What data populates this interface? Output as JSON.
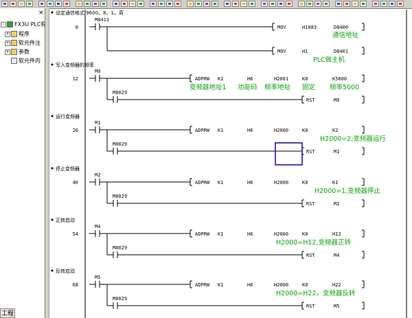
{
  "left_panel": {
    "close_glyph": "×",
    "project_title": "FX3U PLC程",
    "items": [
      {
        "label": "程序",
        "expander": "+"
      },
      {
        "label": "软元件注",
        "expander": "+"
      },
      {
        "label": "参数",
        "expander": "+"
      },
      {
        "label": "软元件内",
        "expander": ""
      }
    ],
    "bottom_tab": "工程"
  },
  "ladder": {
    "rungs": [
      {
        "comment": "设定通信格式 9600，8，1，奇",
        "step": "0",
        "contact": "M8411",
        "outputs": [
          {
            "instr": "MOV",
            "ops": [
              "H1083",
              "D8400"
            ],
            "note": "通信地址"
          },
          {
            "instr": "MOV",
            "ops": [
              "H1",
              "D8401"
            ],
            "note": "PLC做主机"
          }
        ]
      },
      {
        "comment": "写入变频器的频率",
        "step": "12",
        "contact": "M0",
        "instr": "ADPRW",
        "ops": [
          "K1",
          "H6",
          "H2001",
          "K0",
          "K5000"
        ],
        "op_notes": [
          "变频器地址1",
          "功能码",
          "频率地址",
          "固定",
          "频率5000"
        ],
        "contact2": "M8029",
        "rst": "RST",
        "rst_op": "M0"
      },
      {
        "comment": "运行变频器",
        "step": "26",
        "contact": "M1",
        "instr": "ADPRW",
        "ops": [
          "K1",
          "H6",
          "H2000",
          "K0",
          "K2"
        ],
        "note": "H2000=2,变频器运行",
        "contact2": "M8029",
        "rst": "RST",
        "rst_op": "M1"
      },
      {
        "comment": "停止变频器",
        "step": "40",
        "contact": "M2",
        "instr": "ADPRW",
        "ops": [
          "K1",
          "H6",
          "H2000",
          "K0",
          "K1"
        ],
        "note": "H2000=1,变频器停止",
        "contact2": "M8029",
        "rst": "RST",
        "rst_op": "M2"
      },
      {
        "comment": "正转启动",
        "step": "54",
        "contact": "M4",
        "instr": "ADPRW",
        "ops": [
          "K1",
          "H6",
          "H2000",
          "K0",
          "H12"
        ],
        "note": "H2000=H12,变频器正转",
        "contact2": "M8029",
        "rst": "RST",
        "rst_op": "M4"
      },
      {
        "comment": "反转启动",
        "step": "68",
        "contact": "M5",
        "instr": "ADPRW",
        "ops": [
          "K1",
          "H6",
          "H2000",
          "K0",
          "H22"
        ],
        "note": "H2000=H22，变频器反转",
        "contact2": "M8029",
        "rst": "RST",
        "rst_op": "M5"
      }
    ]
  },
  "colors": {
    "annotation": "#10a010",
    "cursor": "#1a1a9a",
    "toolbar": "#d4d0c8"
  }
}
